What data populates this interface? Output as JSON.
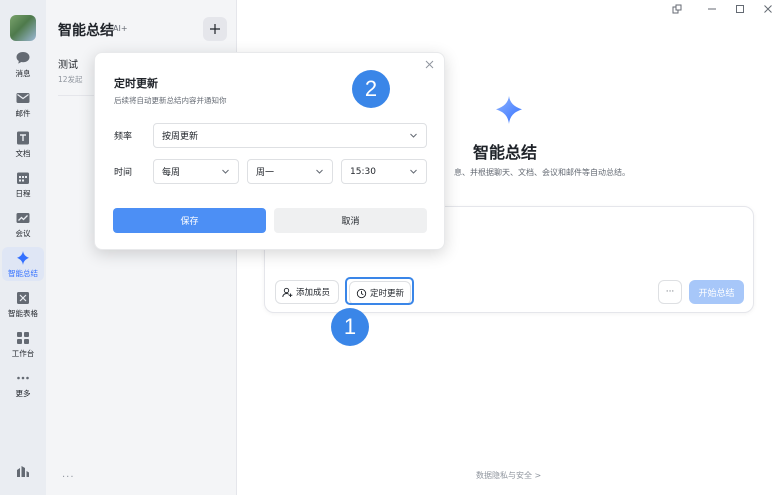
{
  "nav": {
    "items": [
      {
        "label": "消息",
        "icon": "chat-bubble-icon"
      },
      {
        "label": "邮件",
        "icon": "mail-icon"
      },
      {
        "label": "文档",
        "icon": "document-icon"
      },
      {
        "label": "日程",
        "icon": "calendar-icon"
      },
      {
        "label": "会议",
        "icon": "meeting-icon"
      },
      {
        "label": "智能总结",
        "icon": "sparkle-icon"
      },
      {
        "label": "智能表格",
        "icon": "smart-table-icon"
      },
      {
        "label": "工作台",
        "icon": "workbench-icon"
      },
      {
        "label": "更多",
        "icon": "more-dots-icon"
      }
    ],
    "active_color": "#3370ff"
  },
  "list": {
    "title": "智能总结",
    "badge": "AI+",
    "items": [
      {
        "title": "测试",
        "subtitle": "12发起"
      }
    ],
    "more": "···"
  },
  "main": {
    "title": "智能总结",
    "subtitle": "息、并根据聊天、文档、会议和邮件等自动总结。",
    "add_member": "添加成员",
    "schedule": "定时更新",
    "more": "···",
    "start": "开始总结",
    "footer": "数据隐私与安全 >"
  },
  "popup": {
    "title": "定时更新",
    "description": "后续将自动更新总结内容并通知你",
    "frequency_label": "频率",
    "frequency_value": "按周更新",
    "time_label": "时间",
    "period_value": "每周",
    "day_value": "周一",
    "time_value": "15:30",
    "save": "保存",
    "cancel": "取消"
  },
  "steps": {
    "one": "1",
    "two": "2"
  },
  "colors": {
    "accent": "#3a86e8",
    "primary_button": "#4c8ff5",
    "disabled_button": "#a7c7f9"
  }
}
